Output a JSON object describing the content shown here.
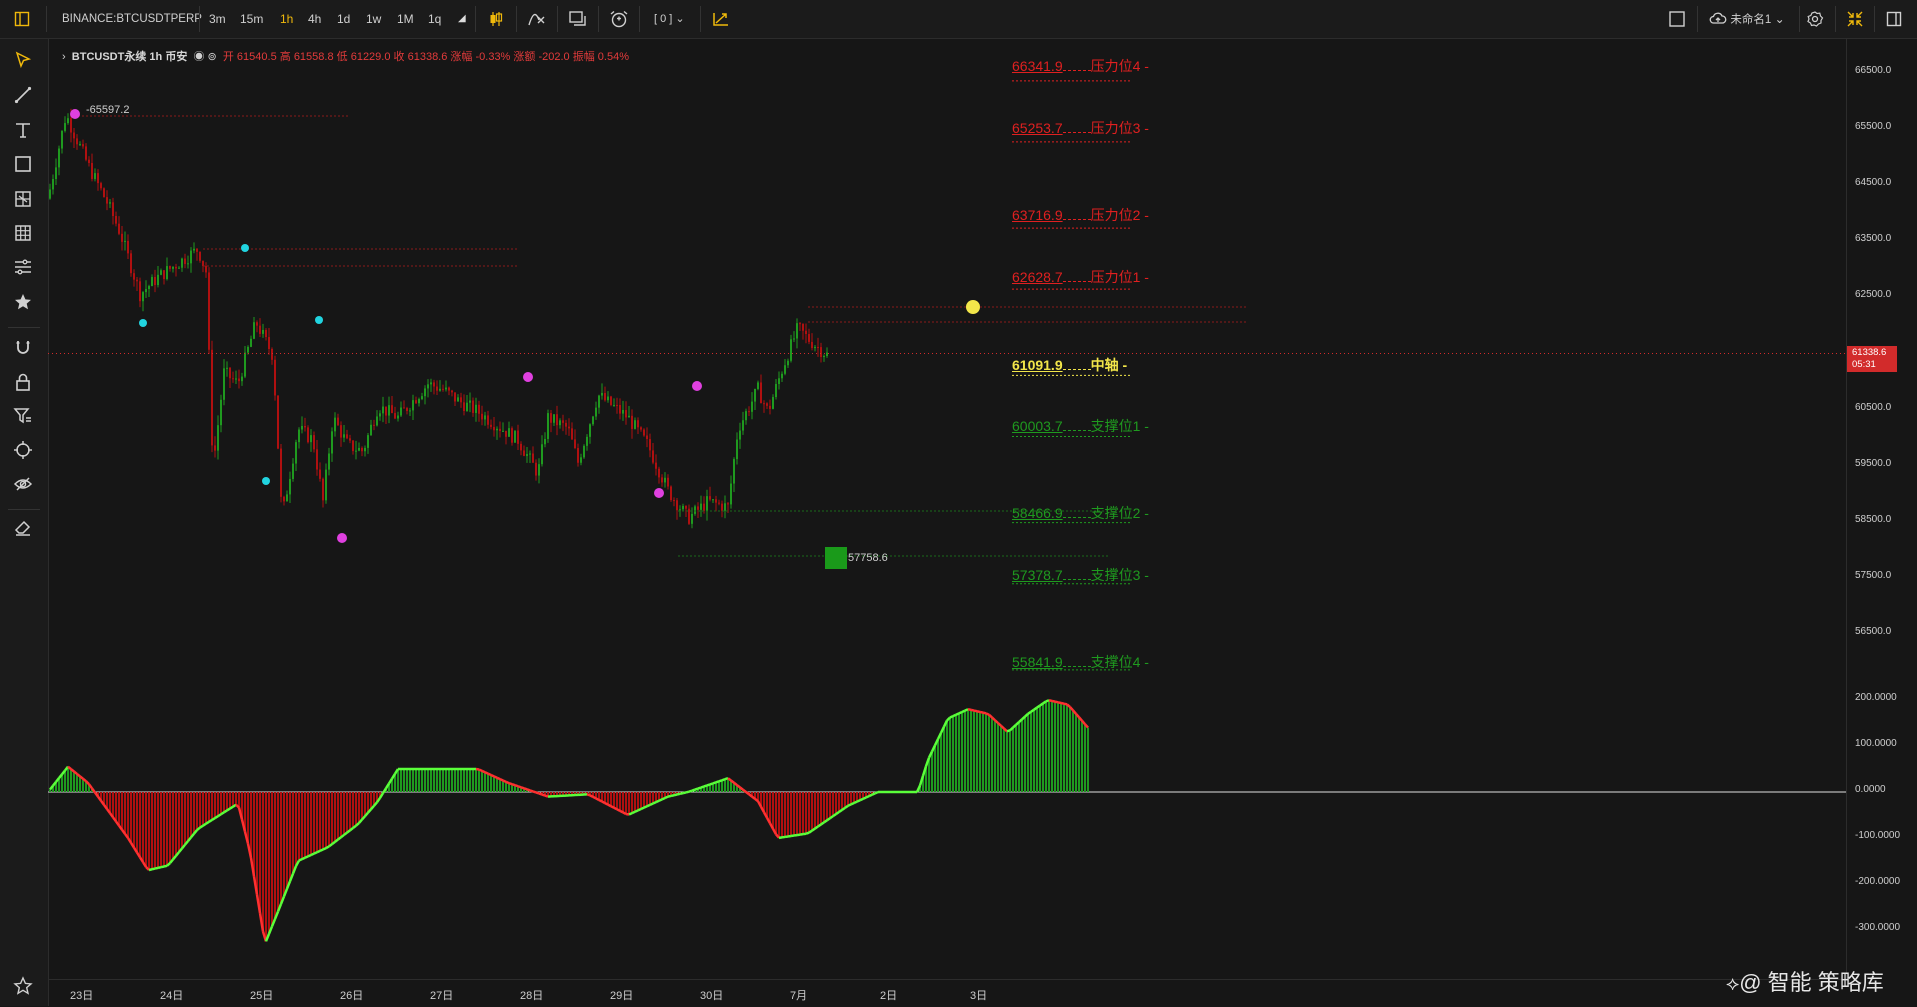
{
  "toolbar": {
    "symbol": "BINANCE:BTCUSDTPERP",
    "timeframes": [
      "3m",
      "15m",
      "1h",
      "4h",
      "1d",
      "1w",
      "1M",
      "1q"
    ],
    "active_timeframe": "1h",
    "bracket_label": "[ 0 ]",
    "layout_name": "未命名1"
  },
  "legend": {
    "symbol": "BTCUSDT永续",
    "interval": "1h",
    "exchange": "币安",
    "open_label": "开",
    "open": "61540.5",
    "high_label": "高",
    "high": "61558.8",
    "low_label": "低",
    "low": "61229.0",
    "close_label": "收",
    "close": "61338.6",
    "change_pct_label": "涨幅",
    "change_pct": "-0.33%",
    "change_amt_label": "涨额",
    "change_amt": "-202.0",
    "amplitude_label": "振幅",
    "amplitude": "0.54%"
  },
  "price_axis": {
    "labels": [
      "66500.0",
      "65500.0",
      "64500.0",
      "63500.0",
      "62500.0",
      "61500.0",
      "60500.0",
      "59500.0",
      "58500.0",
      "57500.0",
      "56500.0"
    ],
    "current_price": "61338.6",
    "countdown": "05:31"
  },
  "indicator_axis": {
    "labels": [
      "200.0000",
      "100.0000",
      "0.0000",
      "-100.0000",
      "-200.0000",
      "-300.0000"
    ]
  },
  "time_axis": {
    "labels": [
      "23日",
      "24日",
      "25日",
      "26日",
      "27日",
      "28日",
      "29日",
      "30日",
      "7月",
      "2日",
      "3日"
    ]
  },
  "levels": [
    {
      "value": "66341.9",
      "name": "压力位4 -",
      "color": "#e02020"
    },
    {
      "value": "65253.7",
      "name": "压力位3 -",
      "color": "#e02020"
    },
    {
      "value": "63716.9",
      "name": "压力位2 -",
      "color": "#e02020"
    },
    {
      "value": "62628.7",
      "name": "压力位1 -",
      "color": "#e02020"
    },
    {
      "value": "61091.9",
      "name": "中轴 -",
      "color": "#f2e64a"
    },
    {
      "value": "60003.7",
      "name": "支撑位1 -",
      "color": "#1f9a1f"
    },
    {
      "value": "58466.9",
      "name": "支撑位2 -",
      "color": "#1f9a1f"
    },
    {
      "value": "57378.7",
      "name": "支撑位3 -",
      "color": "#1f9a1f"
    },
    {
      "value": "55841.9",
      "name": "支撑位4 -",
      "color": "#1f9a1f"
    }
  ],
  "annotations": {
    "high_mark": "65597.2",
    "low_mark": "57758.6"
  },
  "watermark": "@ 智能 策略库",
  "colors": {
    "up": "#1f9a1f",
    "down": "#b01010",
    "resistance": "#e02020",
    "support": "#1f9a1f",
    "pivot": "#f2e64a",
    "accent": "#f0b90b"
  }
}
